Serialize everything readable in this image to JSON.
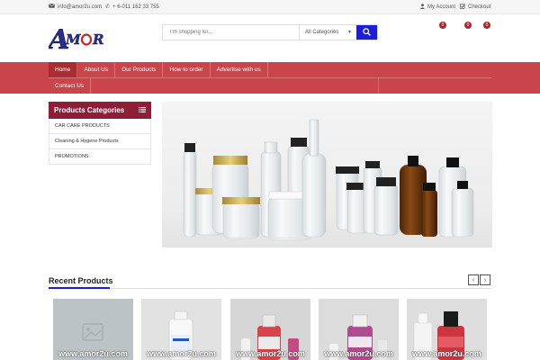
{
  "topbar": {
    "email": "info@amor2u.com",
    "phone": "+ 6-011 162 33 755",
    "my_account": "My Account",
    "checkout": "Checkout"
  },
  "logo": {
    "text": "AMOR"
  },
  "search": {
    "placeholder": "I'm shopping for...",
    "category": "All Categories"
  },
  "header_badges": [
    "0",
    "0",
    "0"
  ],
  "nav": {
    "items": [
      "Home",
      "About Us",
      "Our Products",
      "How to order",
      "Advertise with us"
    ],
    "contact": "Contact Us"
  },
  "categories": {
    "title": "Products Categories",
    "items": [
      "CAR CARE PRODUCTS",
      "Cleaning & Hygene Products",
      "PROMOTIONS"
    ]
  },
  "recent": {
    "title": "Recent Products",
    "watermark": "www.amor2u.com"
  },
  "colors": {
    "nav_red": "#c9444b",
    "category_head": "#8e1d38",
    "accent_blue": "#1c1fd8"
  }
}
